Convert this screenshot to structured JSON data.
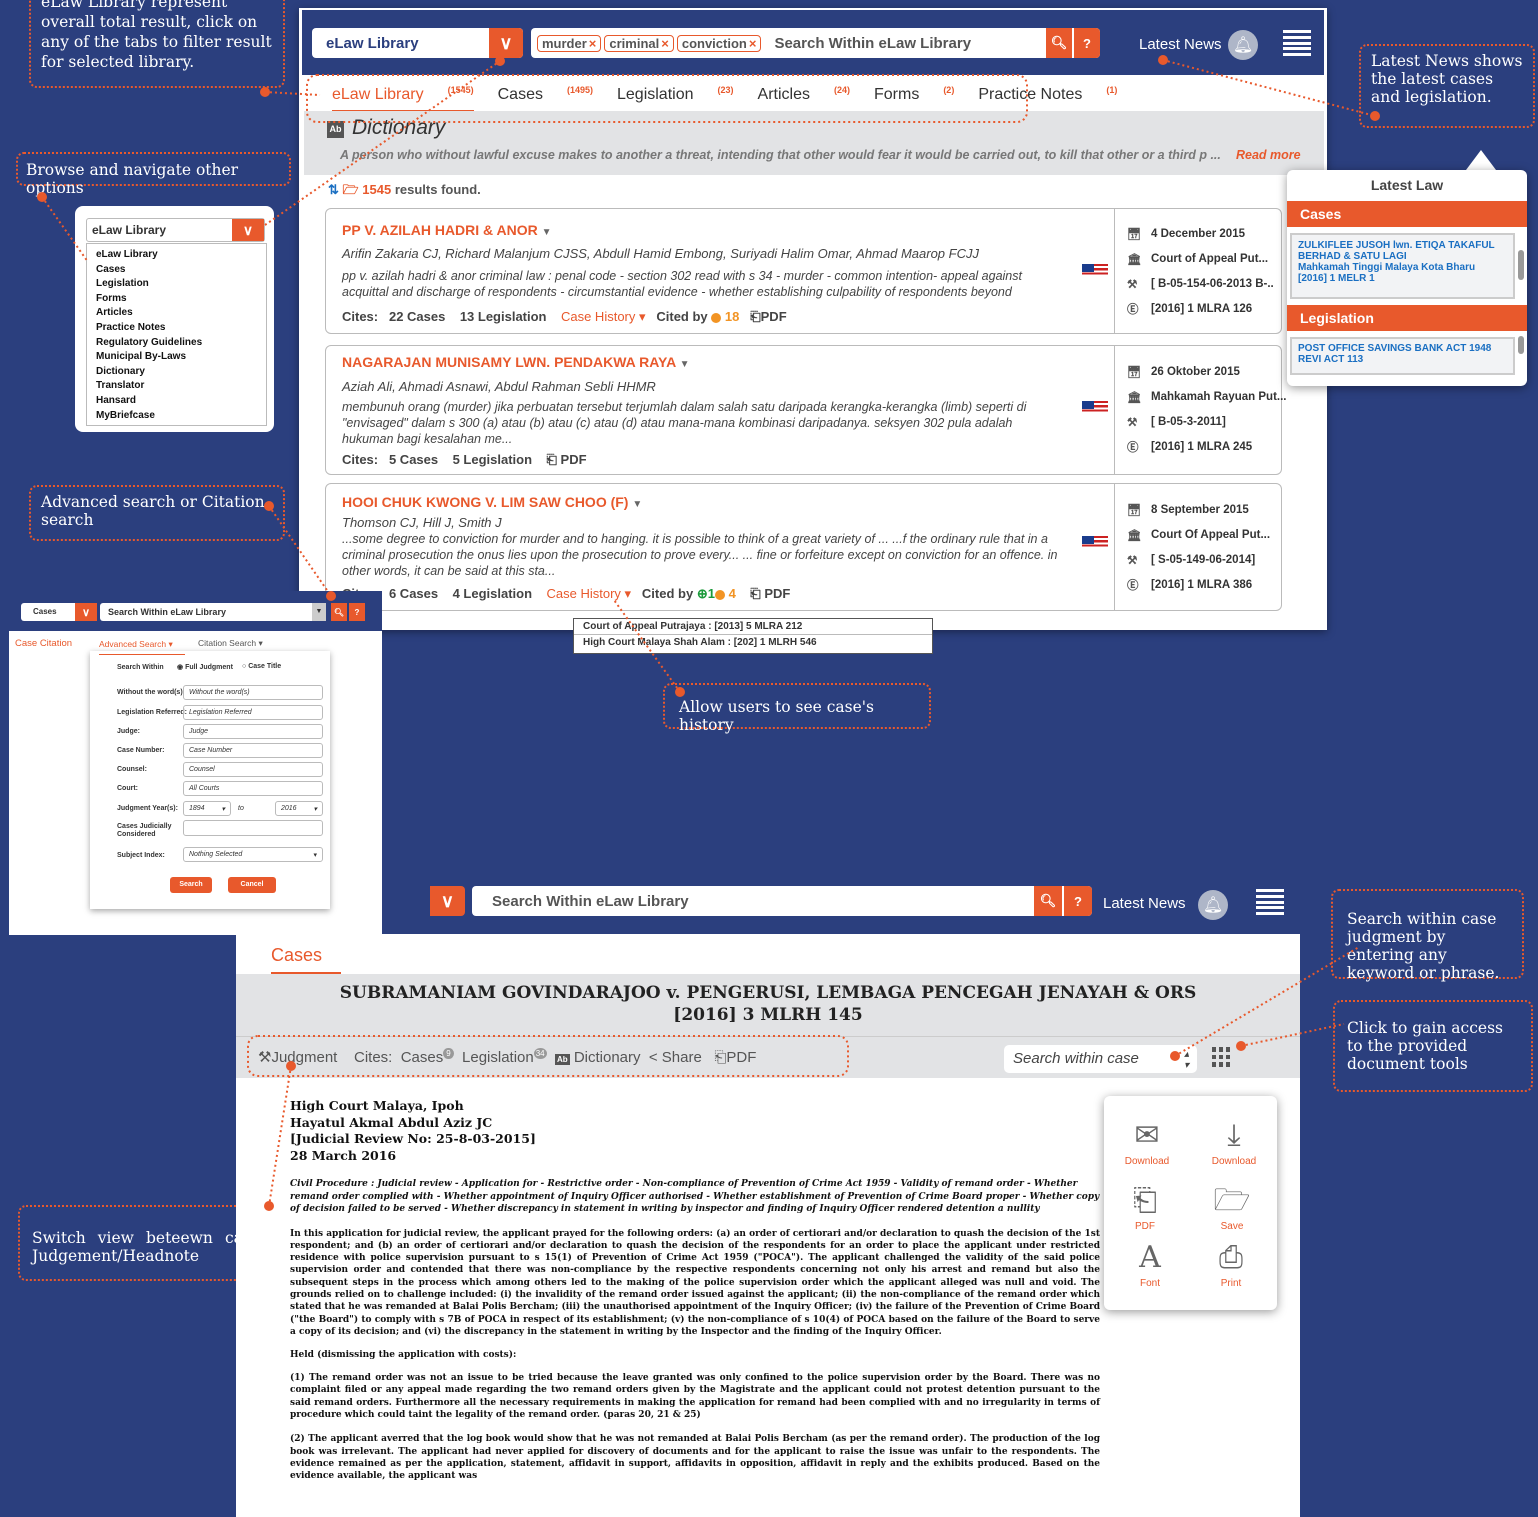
{
  "callouts": {
    "overall": "eLaw Library represent overall total result, click on any of the tabs to filter result for selected library.",
    "browse": "Browse and navigate other options",
    "advanced": "Advanced search or Citation search",
    "history": "Allow users to see case's history",
    "latest_news": "Latest News shows the latest cases and legislation.",
    "search_within": "Search within case judgment by entering any keyword or phrase.",
    "tools": "Click to gain access to the provided document tools",
    "switch_view": "Switch view beteewn case Judgement/Headnote"
  },
  "main": {
    "library_select": "eLaw Library",
    "tags": [
      "murder",
      "criminal",
      "conviction"
    ],
    "search_placeholder": "Search Within eLaw Library",
    "latest_news": "Latest News",
    "tabs": [
      {
        "label": "eLaw Library",
        "count": "(1545)"
      },
      {
        "label": "Cases",
        "count": "(1495)"
      },
      {
        "label": "Legislation",
        "count": "(23)"
      },
      {
        "label": "Articles",
        "count": "(24)"
      },
      {
        "label": "Forms",
        "count": "(2)"
      },
      {
        "label": "Practice Notes",
        "count": "(1)"
      }
    ],
    "dictionary": {
      "title": "Dictionary",
      "text": "A person who without lawful excuse makes to another a threat, intending that other would fear it would be carried out, to kill that other or a third p ...",
      "read_more": "Read more"
    },
    "results_count": "1545",
    "results_label": "results found.",
    "cases": [
      {
        "title": "PP V. AZILAH HADRI & ANOR",
        "judges": "Arifin Zakaria CJ, Richard Malanjum CJSS, Abdull Hamid Embong, Suriyadi Halim Omar, Ahmad Maarop FCJJ",
        "desc": "pp v. azilah hadri & anor criminal law : penal code - section 302 read with s 34 - murder - common intention- appeal against acquittal and discharge of respondents - circumstantial evidence - whether establishing culpability of respondents beyond",
        "cites_label": "Cites:",
        "cases": "22 Cases",
        "legislation": "13 Legislation",
        "history": "Case History",
        "cited_by": "Cited by",
        "cited_count": "18",
        "pdf": "PDF",
        "date": "4 December 2015",
        "court": "Court of Appeal Put...",
        "case_no": "[ B-05-154-06-2013 B-..",
        "citation": "[2016] 1 MLRA 126"
      },
      {
        "title": "NAGARAJAN MUNISAMY LWN. PENDAKWA RAYA",
        "judges": "Aziah Ali, Ahmadi Asnawi, Abdul Rahman Sebli HHMR",
        "desc": "membunuh orang (murder) jika perbuatan tersebut terjumlah dalam salah satu daripada kerangka-kerangka (limb) seperti di \"envisaged\" dalam s 300 (a) atau (b) atau (c) atau (d) atau mana-mana kombinasi daripadanya. seksyen 302 pula adalah hukuman bagi kesalahan me...",
        "cites_label": "Cites:",
        "cases": "5 Cases",
        "legislation": "5 Legislation",
        "pdf": "PDF",
        "date": "26 Oktober 2015",
        "court": "Mahkamah Rayuan Put...",
        "case_no": "[ B-05-3-2011]",
        "citation": "[2016] 1 MLRA 245"
      },
      {
        "title": "HOOI CHUK KWONG V. LIM SAW CHOO (F)",
        "judges": "Thomson CJ, Hill J, Smith J",
        "desc": "...some degree to conviction for murder and to hanging. it is possible to think of a great variety of ... ...f the ordinary rule that in a criminal prosecution the onus lies upon the prosecution to prove every... ... fine or forfeiture except on conviction for an offence. in other words, it can be said at this sta...",
        "cites_label": "Cites:",
        "cases": "6 Cases",
        "legislation": "4 Legislation",
        "history": "Case History",
        "cited_by": "Cited by",
        "cited_green": "1",
        "cited_count": "4",
        "pdf": "PDF",
        "date": "8 September 2015",
        "court": "Court Of Appeal Put...",
        "case_no": "[ S-05-149-06-2014]",
        "citation": "[2016] 1 MLRA 386"
      }
    ],
    "history_rows": [
      "Court of Appeal Putrajaya : [2013] 5 MLRA 212",
      "High Court Malaya Shah Alam : [202] 1 MLRH 546"
    ]
  },
  "latest_law": {
    "title": "Latest Law",
    "cases_header": "Cases",
    "cases_items": [
      "ZULKIFLEE JUSOH lwn. ETIQA TAKAFUL BERHAD & SATU LAGI",
      "Mahkamah Tinggi Malaya Kota Bharu",
      "[2016] 1 MELR 1"
    ],
    "leg_header": "Legislation",
    "leg_items": [
      "POST OFFICE SAVINGS BANK ACT 1948 REVI ACT 113"
    ]
  },
  "dropdown": {
    "selected": "eLaw Library",
    "options": [
      "eLaw Library",
      "Cases",
      "Legislation",
      "Forms",
      "Articles",
      "Practice Notes",
      "Regulatory Guidelines",
      "Municipal By-Laws",
      "Dictionary",
      "Translator",
      "Hansard",
      "MyBriefcase"
    ]
  },
  "advanced": {
    "select": "Cases",
    "search": "Search Within eLaw Library",
    "tabs": [
      "Case Citation",
      "Advanced Search",
      "Citation Search"
    ],
    "search_within": "Search Within",
    "opt_full": "Full Judgment",
    "opt_title": "Case Title",
    "rows": [
      {
        "label": "Without the word(s)",
        "value": "Without the word(s)"
      },
      {
        "label": "Legislation Referred:",
        "value": "Legislation Referred"
      },
      {
        "label": "Judge:",
        "value": "Judge"
      },
      {
        "label": "Case Number:",
        "value": "Case Number"
      },
      {
        "label": "Counsel:",
        "value": "Counsel"
      },
      {
        "label": "Court:",
        "value": "All Courts"
      }
    ],
    "year_label": "Judgment Year(s):",
    "year_from": "1894",
    "to": "to",
    "year_to": "2016",
    "judicially": "Cases Judicially Considered",
    "subject_label": "Subject Index:",
    "subject_value": "Nothing Selected",
    "search_btn": "Search",
    "cancel_btn": "Cancel"
  },
  "doc": {
    "search_placeholder": "Search Within eLaw Library",
    "latest_news": "Latest News",
    "tab": "Cases",
    "title1": "SUBRAMANIAM GOVINDARAJOO v. PENGERUSI, LEMBAGA PENCEGAH JENAYAH & ORS",
    "title2": "[2016] 3 MLRH 145",
    "toolbar": {
      "judgment": "Judgment",
      "cites": "Cites:",
      "cases": "Cases",
      "cases_n": "9",
      "legislation": "Legislation",
      "leg_n": "34",
      "dictionary": "Dictionary",
      "share": "Share",
      "pdf": "PDF",
      "search_within": "Search within case"
    },
    "tools": [
      "Download",
      "Download",
      "PDF",
      "Save",
      "Font",
      "Print"
    ],
    "court": "High Court Malaya, Ipoh",
    "judge": "Hayatul Akmal Abdul Aziz JC",
    "review_no": "[Judicial Review No: 25-8-03-2015]",
    "date": "28 March 2016",
    "headnote": "Civil Procedure : Judicial review - Application for - Restrictive order - Non-compliance of Prevention of Crime Act 1959 - Validity of remand order - Whether remand order complied with - Whether appointment of Inquiry Officer authorised - Whether establishment of Prevention of Crime Board proper - Whether copy of decision failed to be served - Whether discrepancy in statement in writing by inspector and finding of Inquiry Officer rendered detention a nullity",
    "para1": "In this application for judicial review, the applicant prayed for the following orders: (a) an order of certiorari and/or declaration to quash the decision of the 1st respondent; and (b) an order of certiorari and/or declaration to quash the decision of the respondents for an order to place the applicant under restricted residence with police supervision pursuant to s 15(1) of Prevention of Crime Act 1959 (\"POCA\"). The applicant challenged the validity of the said police supervision order and contended that there was non-compliance by the respective respondents concerning not only his arrest and remand but also the subsequent steps in the process which among others led to the making of the police supervision order which the applicant alleged was null and void. The grounds relied on to challenge included: (i) the invalidity of the remand order issued against the applicant; (ii) the non-compliance of the remand order which stated that he was remanded at Balai Polis Bercham; (iii) the unauthorised appointment of the Inquiry Officer; (iv) the failure of the Prevention of Crime Board (\"the Board\") to comply with s 7B of POCA in respect of its establishment; (v) the non-compliance of s 10(4) of POCA based on the failure of the Board to serve a copy of its decision; and (vi) the discrepancy in the statement in writing by the Inspector and the finding of the Inquiry Officer.",
    "held": "Held (dismissing the application with costs):",
    "para2": "(1) The remand order was not an issue to be tried because the leave granted was only confined to the police supervision order by the Board. There was no complaint filed or any appeal made regarding the two remand orders given by the Magistrate and the applicant could not protest detention pursuant to the said remand orders. Furthermore all the necessary requirements in making the application for remand had been complied with and no irregularity in terms of procedure which could taint the legality of the remand order. (paras 20, 21 & 25)",
    "para3": "(2) The applicant averred that the log book would show that he was not remanded at Balai Polis Bercham (as per the remand order). The production of the log book was irrelevant. The applicant had never applied for discovery of documents and for the applicant to raise the issue was unfair to the respondents. The evidence remained as per the application, statement, affidavit in support, affidavits in opposition, affidavit in reply and the exhibits produced. Based on the evidence available, the applicant was"
  },
  "colors": {
    "brand_blue": "#2b3f7e",
    "accent_orange": "#e8592c"
  }
}
